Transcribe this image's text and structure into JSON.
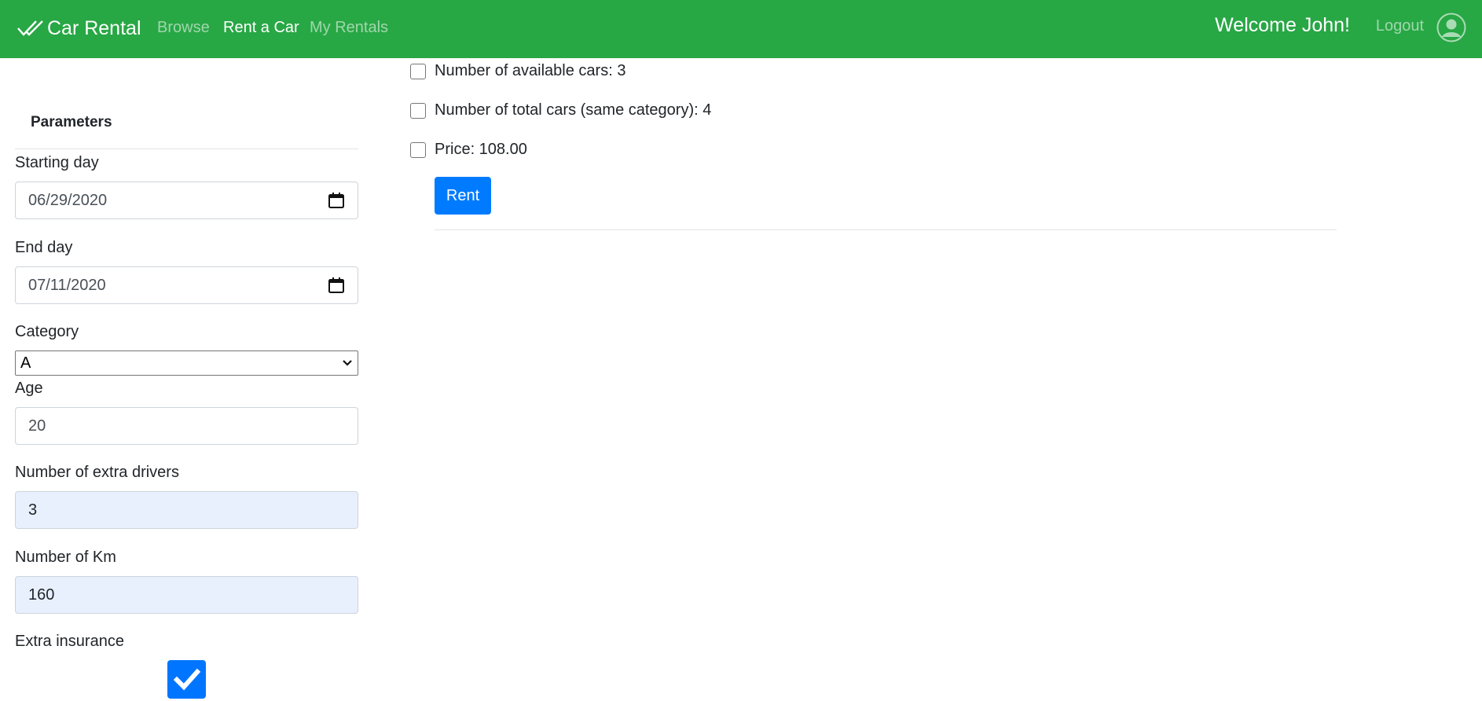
{
  "navbar": {
    "brand": "Car Rental",
    "links": [
      "Browse",
      "Rent a Car",
      "My Rentals"
    ],
    "active_link": "Rent a Car",
    "welcome": "Welcome John!",
    "logout": "Logout",
    "bg_color": "#28a745",
    "brand_icon": "double-check-icon",
    "avatar_icon": "user-circle-icon"
  },
  "sidebar": {
    "title": "Parameters",
    "starting_day": {
      "label": "Starting day",
      "value": "06/29/2020"
    },
    "end_day": {
      "label": "End day",
      "value": "07/11/2020"
    },
    "category": {
      "label": "Category",
      "value": "A"
    },
    "age": {
      "label": "Age",
      "value": "20"
    },
    "extra_drivers": {
      "label": "Number of extra drivers",
      "value": "3"
    },
    "km": {
      "label": "Number of Km",
      "value": "160"
    },
    "extra_insurance": {
      "label": "Extra insurance",
      "checked": true
    }
  },
  "main": {
    "options": [
      {
        "label": "Number of available cars: 3",
        "checked": false
      },
      {
        "label": "Number of total cars (same category): 4",
        "checked": false
      },
      {
        "label": "Price: 108.00",
        "checked": false
      }
    ],
    "rent_button": "Rent",
    "accent_color": "#007bff"
  }
}
